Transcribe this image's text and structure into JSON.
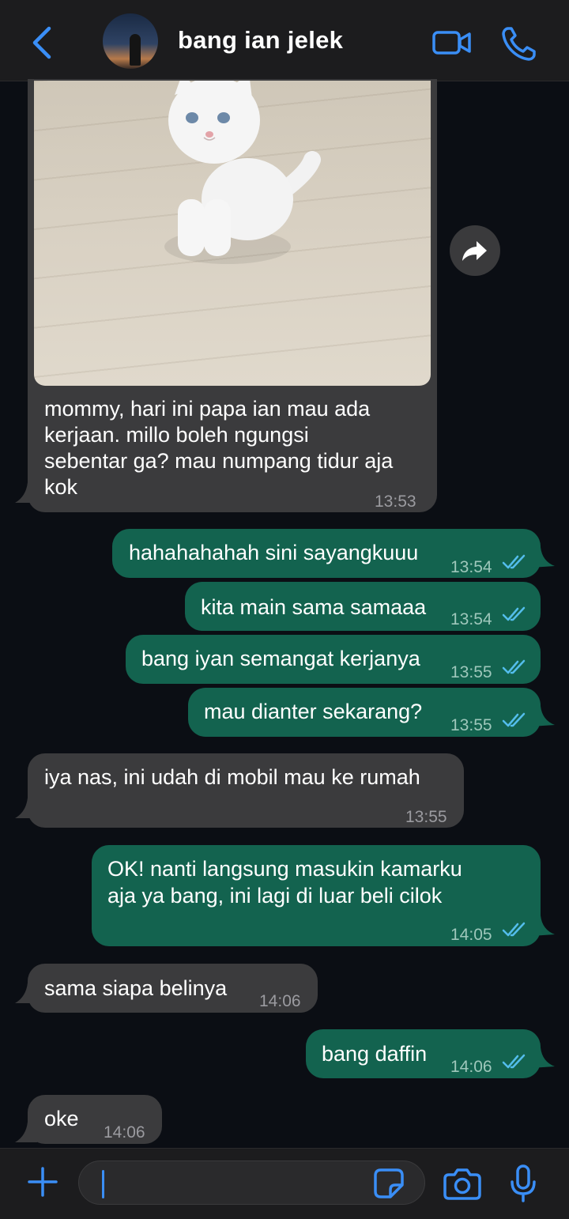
{
  "header": {
    "contact_name": "bang ian jelek",
    "accent_color": "#3a8ef6"
  },
  "messages": [
    {
      "direction": "in",
      "type": "photo",
      "caption_lines": [
        "mommy, hari ini papa ian mau ada",
        "kerjaan. millo boleh ngungsi",
        "sebentar ga? mau numpang tidur aja",
        "kok"
      ],
      "time": "13:53"
    },
    {
      "direction": "out",
      "text": "hahahahahah sini sayangkuuu",
      "time": "13:54",
      "status": "read"
    },
    {
      "direction": "out",
      "text": "kita main sama samaaa",
      "time": "13:54",
      "status": "read"
    },
    {
      "direction": "out",
      "text": "bang iyan semangat kerjanya",
      "time": "13:55",
      "status": "read"
    },
    {
      "direction": "out",
      "text": "mau dianter sekarang?",
      "time": "13:55",
      "status": "read"
    },
    {
      "direction": "in",
      "text": "iya nas, ini udah di mobil mau ke rumah",
      "time": "13:55"
    },
    {
      "direction": "out",
      "lines": [
        "OK! nanti langsung masukin kamarku",
        "aja ya bang, ini lagi di luar beli cilok"
      ],
      "time": "14:05",
      "status": "read"
    },
    {
      "direction": "in",
      "text": "sama siapa belinya",
      "time": "14:06"
    },
    {
      "direction": "out",
      "text": "bang daffin",
      "time": "14:06",
      "status": "read"
    },
    {
      "direction": "in",
      "text": "oke",
      "time": "14:06"
    }
  ],
  "colors": {
    "incoming_bubble": "#3b3b3d",
    "outgoing_bubble": "#13634f",
    "read_ticks": "#53bdeb",
    "background": "#0b0e14"
  },
  "icons": {
    "back": "chevron-left-icon",
    "video": "video-camera-icon",
    "call": "phone-icon",
    "forward": "forward-arrow-icon",
    "plus": "plus-icon",
    "sticker": "sticker-icon",
    "camera": "camera-icon",
    "mic": "microphone-icon"
  }
}
